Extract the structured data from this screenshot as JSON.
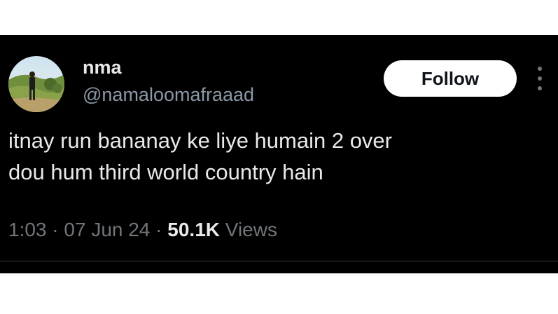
{
  "author": {
    "display_name": "nma",
    "handle": "@namaloomafraaad",
    "avatar_icon": "profile-photo-person-outdoors"
  },
  "follow_button": {
    "label": "Follow"
  },
  "more_options": {
    "icon": "vertical-ellipsis-icon"
  },
  "tweet": {
    "lines": [
      "itnay run bananay ke liye humain 2 over",
      "dou hum third world country hain"
    ]
  },
  "meta": {
    "time": "1:03",
    "separator": "·",
    "date": "07 Jun 24",
    "views_count": "50.1K",
    "views_label": "Views"
  },
  "colors": {
    "background": "#000000",
    "text_primary": "#e7e9ea",
    "text_secondary": "#71767b",
    "button_bg": "#ffffff"
  }
}
